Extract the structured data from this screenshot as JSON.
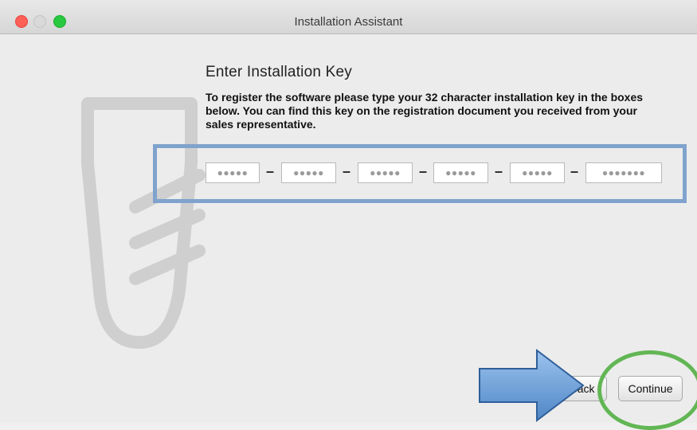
{
  "window": {
    "title": "Installation Assistant"
  },
  "main": {
    "heading": "Enter Installation Key",
    "description": "To register the software please type your 32 character installation key in the boxes below. You can find this key on the registration document you received from your sales representative.",
    "key_fields": [
      "●●●●●",
      "●●●●●",
      "●●●●●",
      "●●●●●",
      "●●●●●",
      "●●●●●●●"
    ],
    "separator": "–"
  },
  "footer": {
    "back_label": "Back",
    "continue_label": "Continue"
  },
  "colors": {
    "highlight_box": "#7fa3cc",
    "arrow": "#6f9fd8",
    "circle": "#62b654",
    "close": "#fe5f57",
    "maximize": "#28c840"
  },
  "icons": [
    "close-icon",
    "minimize-icon",
    "maximize-icon",
    "app-logo-watermark",
    "arrow-annotation",
    "circle-annotation"
  ]
}
